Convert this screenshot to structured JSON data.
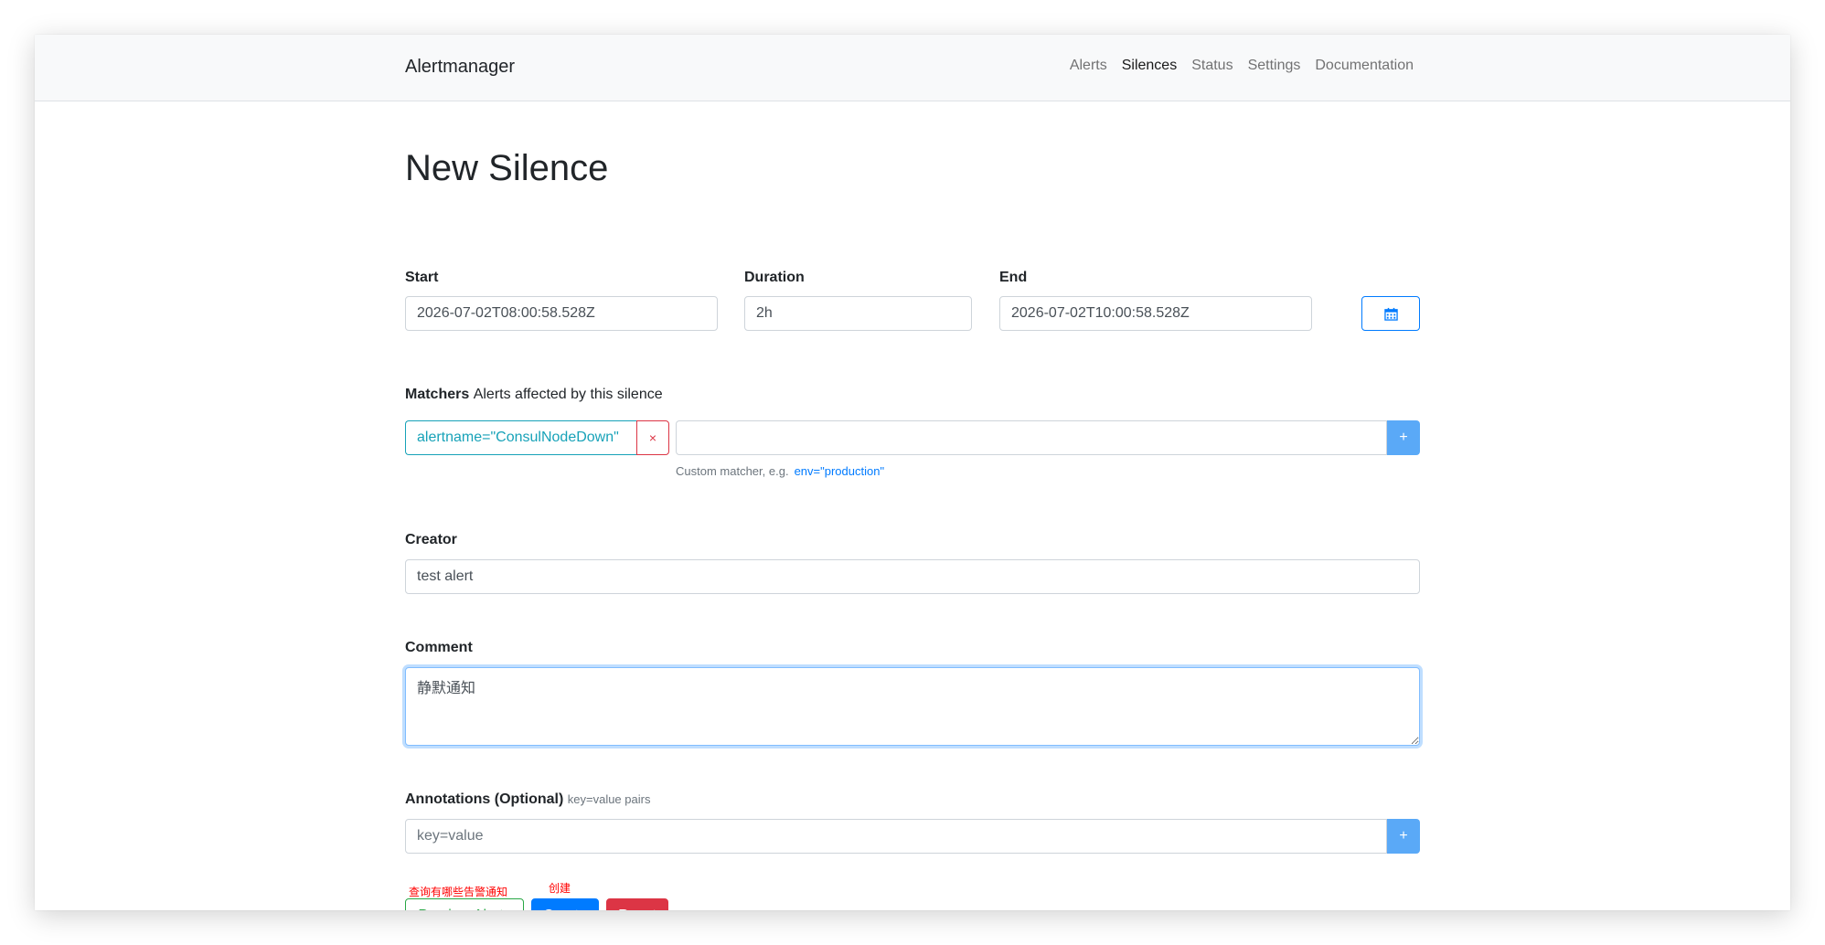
{
  "navbar": {
    "brand": "Alertmanager",
    "links": [
      {
        "label": "Alerts",
        "active": false
      },
      {
        "label": "Silences",
        "active": true
      },
      {
        "label": "Status",
        "active": false
      },
      {
        "label": "Settings",
        "active": false
      },
      {
        "label": "Documentation",
        "active": false
      }
    ]
  },
  "page": {
    "title": "New Silence"
  },
  "form": {
    "start": {
      "label": "Start",
      "value": "2026-07-02T08:00:58.528Z"
    },
    "duration": {
      "label": "Duration",
      "value": "2h"
    },
    "end": {
      "label": "End",
      "value": "2026-07-02T10:00:58.528Z"
    },
    "matchers": {
      "label": "Matchers",
      "sublabel": "Alerts affected by this silence",
      "items": [
        {
          "text": "alertname=\"ConsulNodeDown\"",
          "remove": "×"
        }
      ],
      "input_value": "",
      "hint": "Custom matcher, e.g.",
      "hint_example": "env=\"production\"",
      "add": "+"
    },
    "creator": {
      "label": "Creator",
      "value": "test alert"
    },
    "comment": {
      "label": "Comment",
      "value": "静默通知"
    },
    "annotations": {
      "label": "Annotations (Optional)",
      "sublabel": "key=value pairs",
      "placeholder": "key=value",
      "add": "+"
    }
  },
  "actions": {
    "preview": "Preview Alerts",
    "create": "Create",
    "reset": "Reset"
  },
  "notes": {
    "preview": "查询有哪些告警通知",
    "create": "创建"
  },
  "colors": {
    "primary": "#007bff",
    "success": "#28a745",
    "danger": "#dc3545",
    "info": "#17a2b8",
    "annotation": "#ff0000"
  },
  "icons": {
    "end_picker": "calendar-icon"
  }
}
